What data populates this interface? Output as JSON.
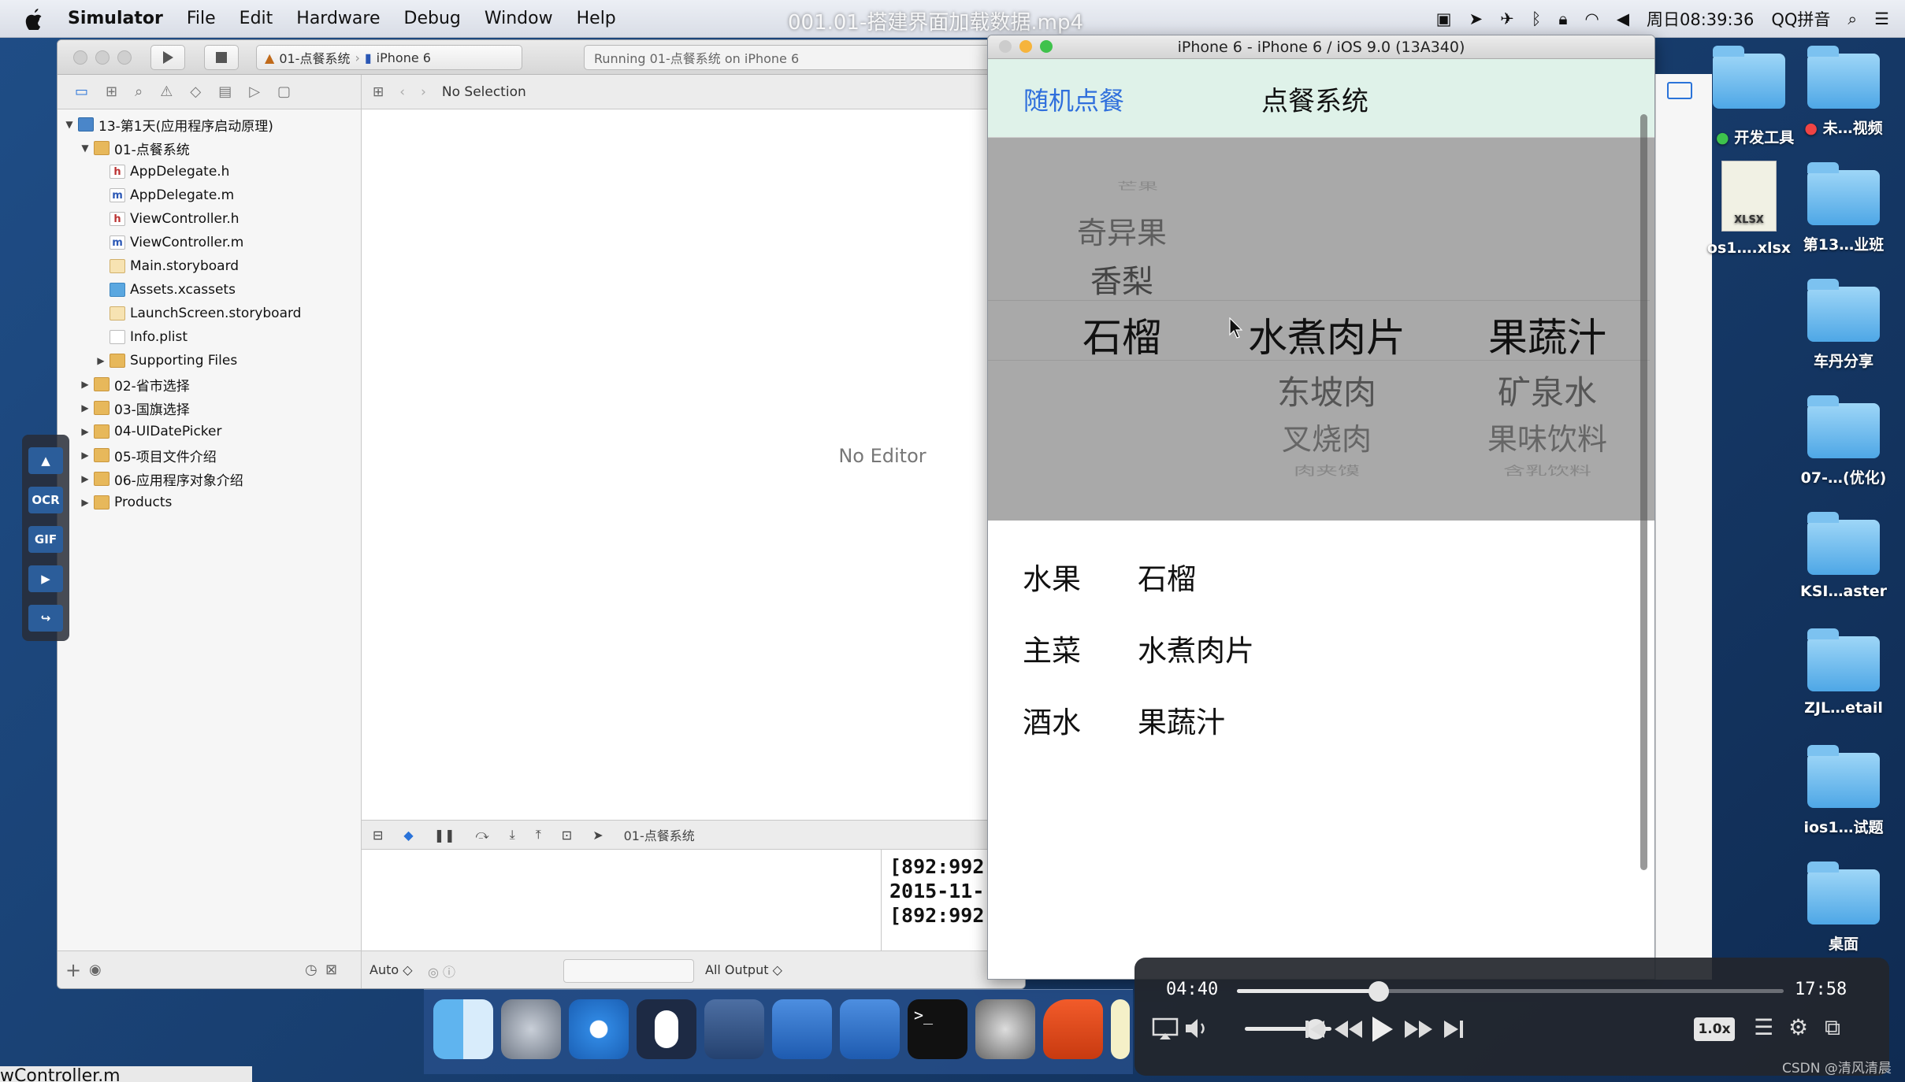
{
  "menubar": {
    "app": "Simulator",
    "items": [
      "File",
      "Edit",
      "Hardware",
      "Debug",
      "Window",
      "Help"
    ],
    "clock": "周日08:39:36",
    "input_method": "QQ拼音"
  },
  "video": {
    "title": "001.01-搭建界面加载数据.mp4",
    "current_time": "04:40",
    "total_time": "17:58",
    "progress": 0.26,
    "volume": 0.82,
    "speed": "1.0x"
  },
  "xcode": {
    "scheme": "01-点餐系统",
    "device": "iPhone 6",
    "activity": "Running 01-点餐系统 on iPhone 6",
    "jumpbar": "No Selection",
    "no_editor": "No Editor",
    "debug_target": "01-点餐系统",
    "auto_label": "Auto ◇",
    "output_label": "All Output ◇",
    "console_lines": [
      "[892:992",
      "2015-11-",
      "[892:992"
    ],
    "tree": [
      {
        "label": "13-第1天(应用程序启动原理)",
        "kind": "proj",
        "depth": 0,
        "disc": "▼"
      },
      {
        "label": "01-点餐系统",
        "kind": "folder",
        "depth": 1,
        "disc": "▼"
      },
      {
        "label": "AppDelegate.h",
        "kind": "h",
        "depth": 2,
        "disc": ""
      },
      {
        "label": "AppDelegate.m",
        "kind": "m",
        "depth": 2,
        "disc": ""
      },
      {
        "label": "ViewController.h",
        "kind": "h",
        "depth": 2,
        "disc": ""
      },
      {
        "label": "ViewController.m",
        "kind": "m",
        "depth": 2,
        "disc": ""
      },
      {
        "label": "Main.storyboard",
        "kind": "sb",
        "depth": 2,
        "disc": ""
      },
      {
        "label": "Assets.xcassets",
        "kind": "as",
        "depth": 2,
        "disc": ""
      },
      {
        "label": "LaunchScreen.storyboard",
        "kind": "sb",
        "depth": 2,
        "disc": ""
      },
      {
        "label": "Info.plist",
        "kind": "pl",
        "depth": 2,
        "disc": ""
      },
      {
        "label": "Supporting Files",
        "kind": "folder",
        "depth": 2,
        "disc": "▶"
      },
      {
        "label": "02-省市选择",
        "kind": "folder",
        "depth": 1,
        "disc": "▶"
      },
      {
        "label": "03-国旗选择",
        "kind": "folder",
        "depth": 1,
        "disc": "▶"
      },
      {
        "label": "04-UIDatePicker",
        "kind": "folder",
        "depth": 1,
        "disc": "▶"
      },
      {
        "label": "05-项目文件介绍",
        "kind": "folder",
        "depth": 1,
        "disc": "▶"
      },
      {
        "label": "06-应用程序对象介绍",
        "kind": "folder",
        "depth": 1,
        "disc": "▶"
      },
      {
        "label": "Products",
        "kind": "folder",
        "depth": 1,
        "disc": "▶"
      }
    ]
  },
  "simulator": {
    "title": "iPhone 6 - iPhone 6 / iOS 9.0 (13A340)",
    "random_label": "随机点餐",
    "system_label": "点餐系统",
    "picker": {
      "col1": [
        "芒果",
        "奇异果",
        "香梨",
        "石榴"
      ],
      "col2": [
        "水煮肉片",
        "东坡肉",
        "叉烧肉",
        "肉夹馍"
      ],
      "col3": [
        "果蔬汁",
        "矿泉水",
        "果味饮料",
        "含乳饮料"
      ]
    },
    "results": [
      {
        "label": "水果",
        "value": "石榴"
      },
      {
        "label": "主菜",
        "value": "水煮肉片"
      },
      {
        "label": "酒水",
        "value": "果蔬汁"
      }
    ]
  },
  "desktop_icons": [
    {
      "label": "",
      "sub": ""
    },
    {
      "label": "开发工具",
      "sub": ""
    },
    {
      "label": "未…视频",
      "sub": ""
    },
    {
      "label": "os1….xlsx",
      "sub": "XLSX"
    },
    {
      "label": "第13…业班",
      "sub": ""
    },
    {
      "label": "车丹分享",
      "sub": ""
    },
    {
      "label": "07-…(优化)",
      "sub": ""
    },
    {
      "label": "KSI…aster",
      "sub": ""
    },
    {
      "label": "ZJL…etail",
      "sub": ""
    },
    {
      "label": "ios1…试题",
      "sub": ""
    },
    {
      "label": "桌面",
      "sub": ""
    }
  ],
  "side_toolbar": [
    "OCR",
    "GIF"
  ],
  "watermark": "CSDN @清风清晨",
  "bottom_text": "wController.m"
}
